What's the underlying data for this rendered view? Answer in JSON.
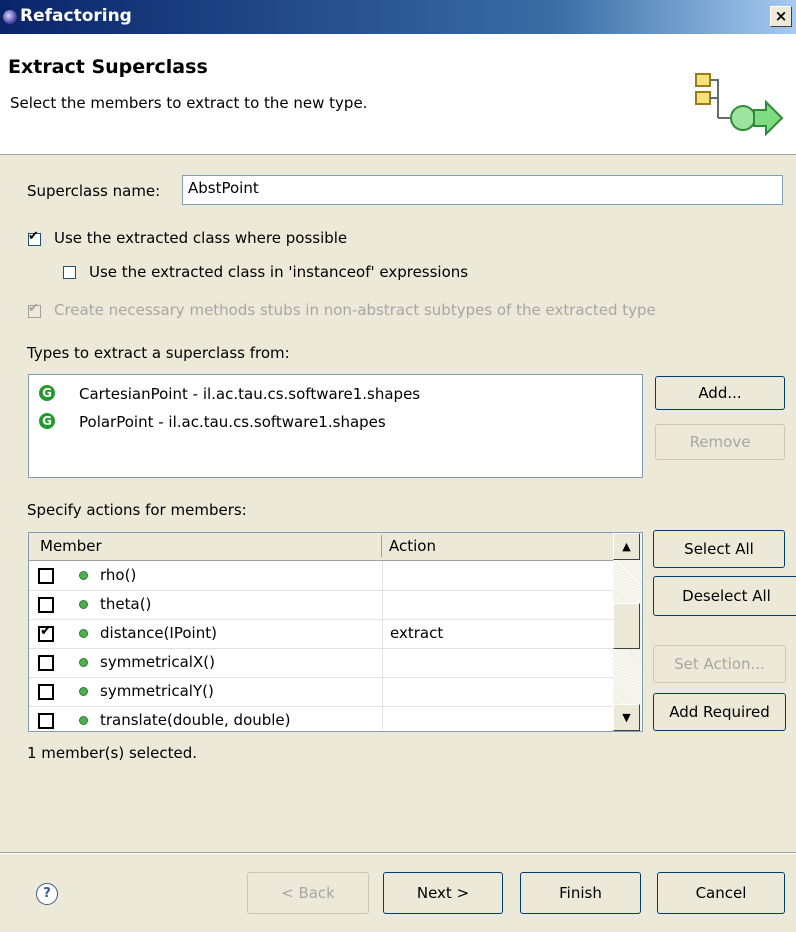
{
  "window": {
    "title": "Refactoring",
    "close_glyph": "×"
  },
  "banner": {
    "title": "Extract Superclass",
    "subtitle": "Select the members to extract to the new type.",
    "icon": "extract-superclass-icon"
  },
  "form": {
    "superclass_label": "Superclass name:",
    "superclass_value": "AbstPoint",
    "use_extracted": {
      "label": "Use the extracted class where possible",
      "checked": true
    },
    "use_instanceof": {
      "label": "Use the extracted class in 'instanceof' expressions",
      "checked": false
    },
    "create_stubs": {
      "label": "Create necessary methods stubs in non-abstract subtypes of the extracted type",
      "checked": true,
      "enabled": false
    }
  },
  "types": {
    "label": "Types to extract a superclass from:",
    "items": [
      {
        "icon": "G",
        "label": "CartesianPoint - il.ac.tau.cs.software1.shapes"
      },
      {
        "icon": "G",
        "label": "PolarPoint - il.ac.tau.cs.software1.shapes"
      }
    ],
    "add_button": "Add...",
    "remove_button": "Remove"
  },
  "members": {
    "label": "Specify actions for members:",
    "columns": {
      "member": "Member",
      "action": "Action"
    },
    "rows": [
      {
        "name": "rho()",
        "action": "",
        "checked": false
      },
      {
        "name": "theta()",
        "action": "",
        "checked": false
      },
      {
        "name": "distance(IPoint)",
        "action": "extract",
        "checked": true
      },
      {
        "name": "symmetricalX()",
        "action": "",
        "checked": false
      },
      {
        "name": "symmetricalY()",
        "action": "",
        "checked": false
      },
      {
        "name": "translate(double, double)",
        "action": "",
        "checked": false
      }
    ],
    "select_all": "Select All",
    "deselect_all": "Deselect All",
    "set_action": "Set Action...",
    "add_required": "Add Required",
    "status": "1 member(s) selected."
  },
  "footer": {
    "help": "?",
    "back": "< Back",
    "next": "Next >",
    "finish": "Finish",
    "cancel": "Cancel"
  }
}
